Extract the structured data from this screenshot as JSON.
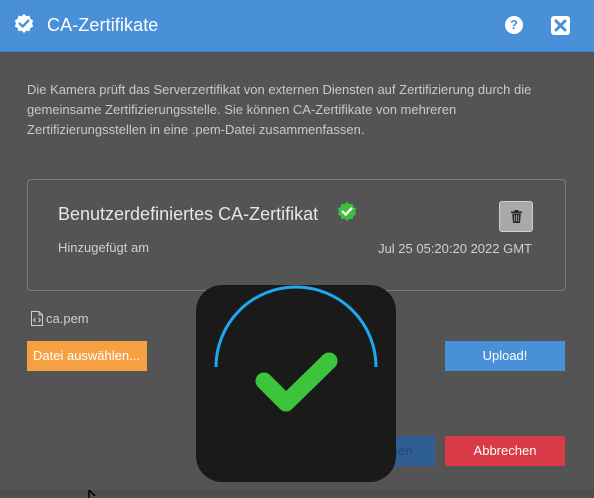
{
  "header": {
    "title": "CA-Zertifikate",
    "title_icon": "verified-badge-icon",
    "help_label": "?",
    "close_icon": "close-icon"
  },
  "description": "Die Kamera prüft das Serverzertifikat von externen Diensten auf Zertifizierung durch die gemeinsame Zertifizierungsstelle. Sie können CA-Zertifikate von mehreren Zertifizierungsstellen in eine .pem-Datei zusammenfassen.",
  "certificate": {
    "name": "Benutzerdefiniertes CA-Zertifikat",
    "verified_icon": "verified-badge-icon",
    "added_label": "Hinzugefügt am",
    "added_date": "Jul 25 05:20:20 2022 GMT",
    "delete_icon": "trash-icon"
  },
  "file": {
    "icon": "file-code-icon",
    "name": "ca.pem"
  },
  "buttons": {
    "choose_file": "Datei auswählen...",
    "upload": "Upload!",
    "apply": "Übernehmen",
    "cancel": "Abbrechen"
  },
  "overlay": {
    "icon": "checkmark-success-icon",
    "progress": 1.0
  },
  "colors": {
    "header": "#4a90d9",
    "background": "#545454",
    "choose_button": "#f5a142",
    "upload_button": "#4a90d9",
    "cancel_button": "#d83b45",
    "success_green": "#3dc43d",
    "spinner_blue": "#1fa9f0"
  }
}
